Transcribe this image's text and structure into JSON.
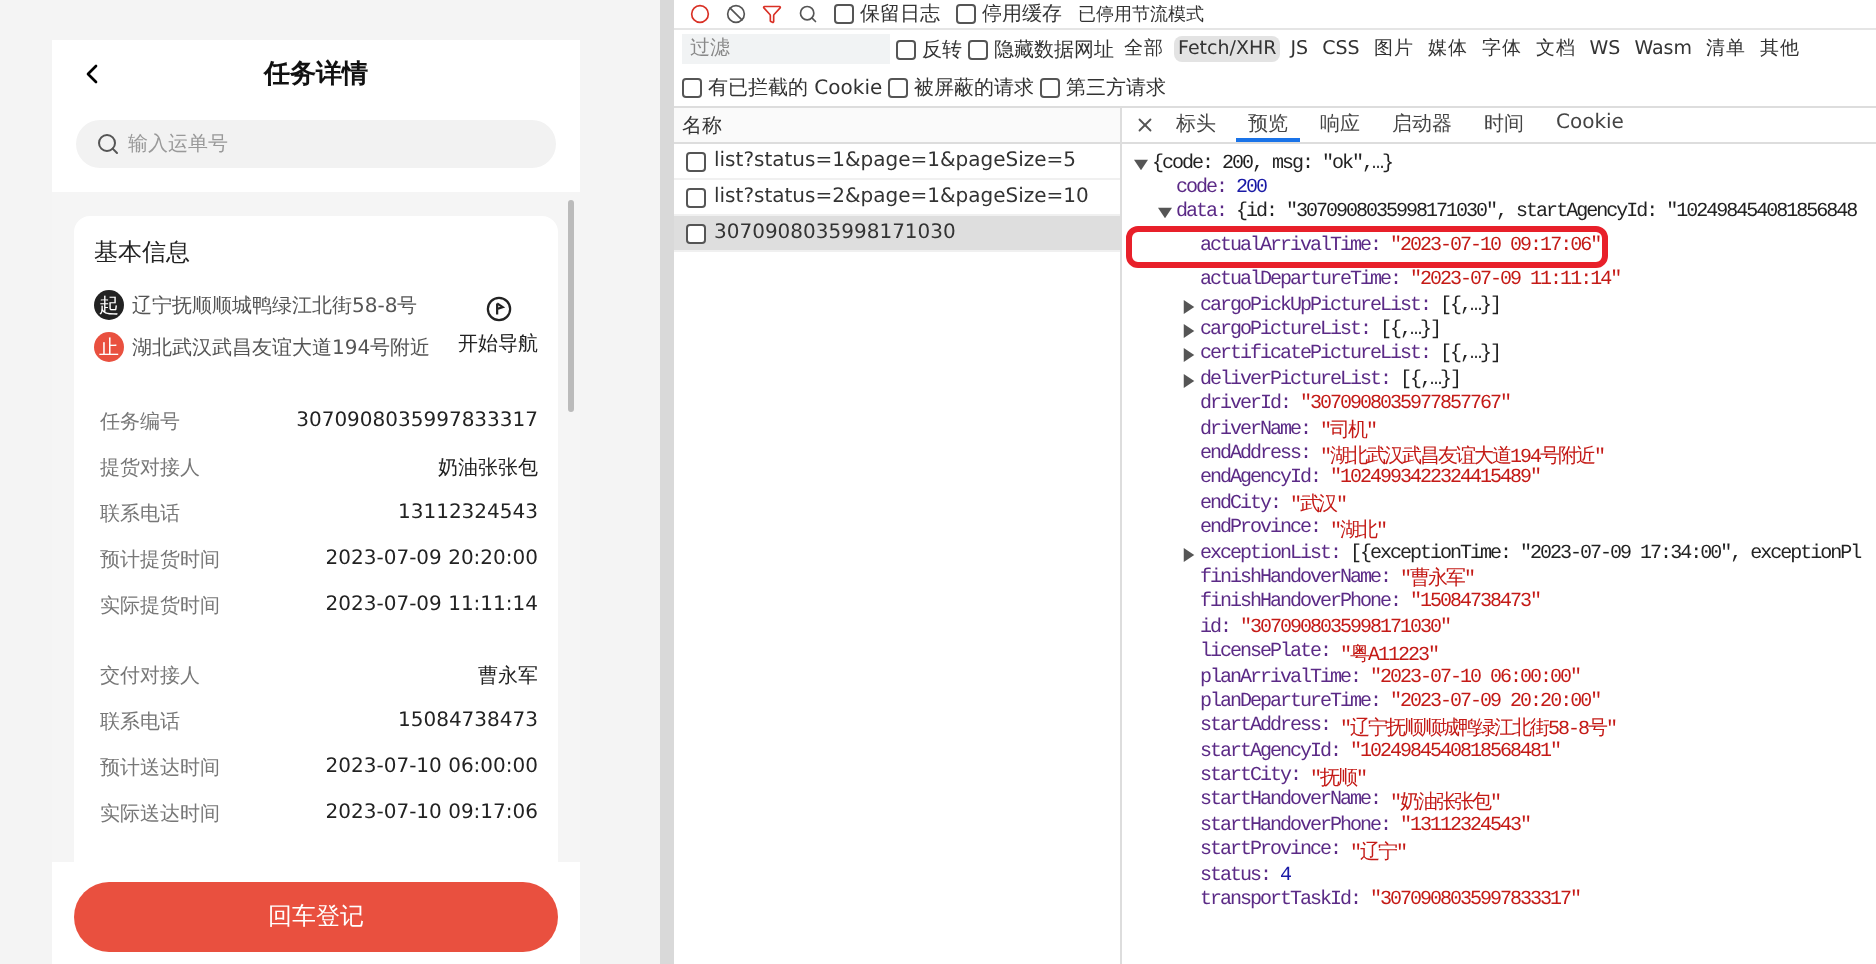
{
  "phone": {
    "title": "任务详情",
    "search": {
      "placeholder": "输入运单号"
    },
    "card": {
      "title": "基本信息",
      "route": [
        {
          "kind": "start",
          "badge": "起",
          "address": "辽宁抚顺顺城鸭绿江北街58-8号"
        },
        {
          "kind": "end",
          "badge": "止",
          "address": "湖北武汉武昌友谊大道194号附近"
        }
      ],
      "navigate": "开始导航",
      "groups": [
        [
          {
            "label": "任务编号",
            "value": "3070908035997833317"
          },
          {
            "label": "提货对接人",
            "value": "奶油张张包"
          },
          {
            "label": "联系电话",
            "value": "13112324543"
          },
          {
            "label": "预计提货时间",
            "value": "2023-07-09 20:20:00"
          },
          {
            "label": "实际提货时间",
            "value": "2023-07-09 11:11:14"
          }
        ],
        [
          {
            "label": "交付对接人",
            "value": "曹永军"
          },
          {
            "label": "联系电话",
            "value": "15084738473"
          },
          {
            "label": "预计送达时间",
            "value": "2023-07-10 06:00:00"
          },
          {
            "label": "实际送达时间",
            "value": "2023-07-10 09:17:06"
          }
        ]
      ]
    },
    "button": "回车登记"
  },
  "devtools": {
    "toolbar": [
      {
        "label": "保留日志",
        "checked": false
      },
      {
        "label": "停用缓存",
        "checked": false
      }
    ],
    "throttle": "已停用节流模式",
    "filter": {
      "placeholder": "过滤",
      "options": [
        {
          "label": "反转",
          "checked": false
        },
        {
          "label": "隐藏数据网址",
          "checked": false
        }
      ],
      "types": [
        {
          "label": "全部",
          "selected": false
        },
        {
          "label": "Fetch/XHR",
          "selected": true
        },
        {
          "label": "JS",
          "selected": false
        },
        {
          "label": "CSS",
          "selected": false
        },
        {
          "label": "图片",
          "selected": false
        },
        {
          "label": "媒体",
          "selected": false
        },
        {
          "label": "字体",
          "selected": false
        },
        {
          "label": "文档",
          "selected": false
        },
        {
          "label": "WS",
          "selected": false
        },
        {
          "label": "Wasm",
          "selected": false
        },
        {
          "label": "清单",
          "selected": false
        },
        {
          "label": "其他",
          "selected": false
        }
      ],
      "more": [
        {
          "label": "有已拦截的 Cookie",
          "checked": false
        },
        {
          "label": "被屏蔽的请求",
          "checked": false
        },
        {
          "label": "第三方请求",
          "checked": false
        }
      ]
    },
    "requests": {
      "header": "名称",
      "items": [
        {
          "name": "list?status=1&page=1&pageSize=5",
          "selected": false
        },
        {
          "name": "list?status=2&page=1&pageSize=10",
          "selected": false
        },
        {
          "name": "3070908035998171030",
          "selected": true
        }
      ]
    },
    "tabs": [
      {
        "label": "标头",
        "selected": false
      },
      {
        "label": "预览",
        "selected": true
      },
      {
        "label": "响应",
        "selected": false
      },
      {
        "label": "启动器",
        "selected": false
      },
      {
        "label": "时间",
        "selected": false
      },
      {
        "label": "Cookie",
        "selected": false
      }
    ],
    "preview": {
      "summary": "{code: 200, msg: \"ok\",…}",
      "expanded": true,
      "children": [
        {
          "key": "code:",
          "value": "200",
          "kind": "number"
        },
        {
          "key": "data:",
          "value": "{id: \"3070908035998171030\", startAgencyId: \"102498454081856848",
          "kind": "object",
          "expanded": true,
          "children": [
            {
              "key": "actualArrivalTime:",
              "value": "\"2023-07-10 09:17:06\"",
              "kind": "string",
              "highlighted": true
            },
            {
              "key": "actualDepartureTime:",
              "value": "\"2023-07-09 11:11:14\"",
              "kind": "string",
              "highlighted": false
            },
            {
              "key": "cargoPickUpPictureList:",
              "value": "[{,…}]",
              "kind": "object",
              "expanded": false,
              "highlighted": false
            },
            {
              "key": "cargoPictureList:",
              "value": "[{,…}]",
              "kind": "object",
              "expanded": false,
              "highlighted": false
            },
            {
              "key": "certificatePictureList:",
              "value": "[{,…}]",
              "kind": "object",
              "expanded": false,
              "highlighted": false
            },
            {
              "key": "deliverPictureList:",
              "value": "[{,…}]",
              "kind": "object",
              "expanded": false,
              "highlighted": false
            },
            {
              "key": "driverId:",
              "value": "\"3070908035977857767\"",
              "kind": "string",
              "highlighted": false
            },
            {
              "key": "driverName:",
              "value": "\"司机\"",
              "kind": "string",
              "highlighted": false
            },
            {
              "key": "endAddress:",
              "value": "\"湖北武汉武昌友谊大道194号附近\"",
              "kind": "string",
              "highlighted": false
            },
            {
              "key": "endAgencyId:",
              "value": "\"1024993422324415489\"",
              "kind": "string",
              "highlighted": false
            },
            {
              "key": "endCity:",
              "value": "\"武汉\"",
              "kind": "string",
              "highlighted": false
            },
            {
              "key": "endProvince:",
              "value": "\"湖北\"",
              "kind": "string",
              "highlighted": false
            },
            {
              "key": "exceptionList:",
              "value": "[{exceptionTime: \"2023-07-09 17:34:00\", exceptionPl",
              "kind": "object",
              "expanded": false,
              "highlighted": false
            },
            {
              "key": "finishHandoverName:",
              "value": "\"曹永军\"",
              "kind": "string",
              "highlighted": false
            },
            {
              "key": "finishHandoverPhone:",
              "value": "\"15084738473\"",
              "kind": "string",
              "highlighted": false
            },
            {
              "key": "id:",
              "value": "\"3070908035998171030\"",
              "kind": "string",
              "highlighted": false
            },
            {
              "key": "licensePlate:",
              "value": "\"粤A11223\"",
              "kind": "string",
              "highlighted": false
            },
            {
              "key": "planArrivalTime:",
              "value": "\"2023-07-10 06:00:00\"",
              "kind": "string",
              "highlighted": false
            },
            {
              "key": "planDepartureTime:",
              "value": "\"2023-07-09 20:20:00\"",
              "kind": "string",
              "highlighted": false
            },
            {
              "key": "startAddress:",
              "value": "\"辽宁抚顺顺城鸭绿江北街58-8号\"",
              "kind": "string",
              "highlighted": false
            },
            {
              "key": "startAgencyId:",
              "value": "\"1024984540818568481\"",
              "kind": "string",
              "highlighted": false
            },
            {
              "key": "startCity:",
              "value": "\"抚顺\"",
              "kind": "string",
              "highlighted": false
            },
            {
              "key": "startHandoverName:",
              "value": "\"奶油张张包\"",
              "kind": "string",
              "highlighted": false
            },
            {
              "key": "startHandoverPhone:",
              "value": "\"13112324543\"",
              "kind": "string",
              "highlighted": false
            },
            {
              "key": "startProvince:",
              "value": "\"辽宁\"",
              "kind": "string",
              "highlighted": false
            },
            {
              "key": "status:",
              "value": "4",
              "kind": "number",
              "highlighted": false
            },
            {
              "key": "transportTaskId:",
              "value": "\"3070908035997833317\"",
              "kind": "string",
              "highlighted": false
            }
          ]
        }
      ]
    }
  }
}
